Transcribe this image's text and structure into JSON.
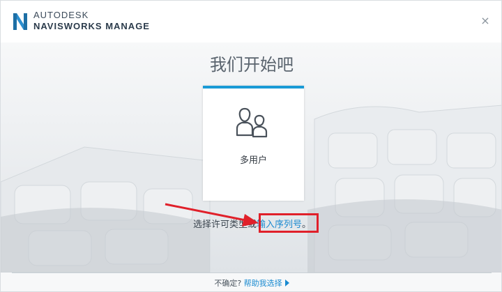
{
  "header": {
    "brand_line1": "AUTODESK",
    "brand_line2": "NAVISWORKS MANAGE",
    "close_symbol": "×",
    "logo_icon": "navisworks-n-logo-icon"
  },
  "main": {
    "title": "我们开始吧",
    "license_card": {
      "icon": "multi-user-icon",
      "label": "多用户"
    },
    "prompt_prefix": "选择许可类型或",
    "serial_link": "输入序列号",
    "prompt_suffix": "。"
  },
  "footer": {
    "question": "不确定?",
    "help_link": "帮助我选择"
  },
  "colors": {
    "accent_blue": "#1a9ad6",
    "link_blue": "#1a8ad0",
    "annotation_red": "#e0202a"
  }
}
